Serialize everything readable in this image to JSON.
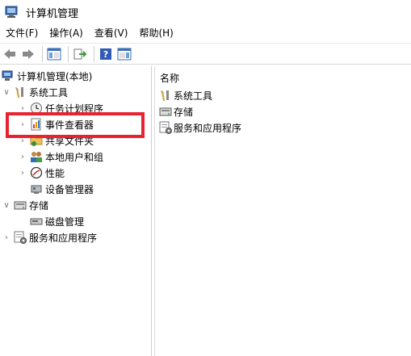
{
  "window": {
    "title": "计算机管理"
  },
  "menu": [
    "文件(F)",
    "操作(A)",
    "查看(V)",
    "帮助(H)"
  ],
  "tree": {
    "root": "计算机管理(本地)",
    "system_tools": "系统工具",
    "task_scheduler": "任务计划程序",
    "event_viewer": "事件查看器",
    "shared_folders": "共享文件夹",
    "local_users": "本地用户和组",
    "performance": "性能",
    "device_manager": "设备管理器",
    "storage": "存储",
    "disk_management": "磁盘管理",
    "services_apps": "服务和应用程序"
  },
  "list": {
    "header": "名称",
    "items": [
      "系统工具",
      "存储",
      "服务和应用程序"
    ]
  },
  "colors": {
    "highlight": "#e8232f"
  }
}
